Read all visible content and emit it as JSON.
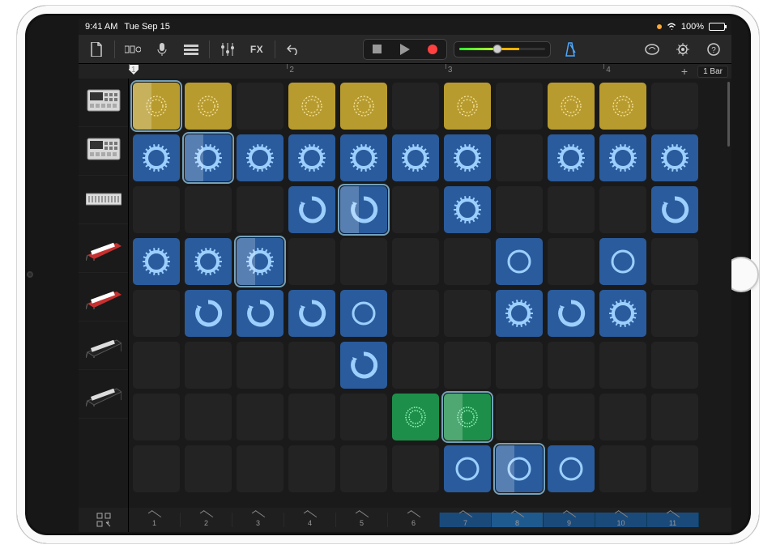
{
  "status": {
    "time": "9:41 AM",
    "date": "Tue Sep 15",
    "battery_pct": "100%"
  },
  "toolbar": {
    "fx_label": "FX",
    "metronome_on": true
  },
  "ruler": {
    "marks": [
      "1",
      "2",
      "3",
      "4"
    ],
    "add": "+",
    "zoom_label": "1 Bar"
  },
  "tracks": [
    {
      "icon": "drum-machine-1",
      "type": "drums"
    },
    {
      "icon": "drum-machine-2",
      "type": "drums"
    },
    {
      "icon": "synth-rack",
      "type": "synth"
    },
    {
      "icon": "keyboard-red-1",
      "type": "keys"
    },
    {
      "icon": "keyboard-red-2",
      "type": "keys"
    },
    {
      "icon": "keyboard-dark-1",
      "type": "keys"
    },
    {
      "icon": "keyboard-dark-2",
      "type": "keys"
    }
  ],
  "grid": {
    "cols": 11,
    "rows": 8,
    "cells": [
      [
        {
          "c": "yellow",
          "i": "dots",
          "p": true
        },
        {
          "c": "yellow",
          "i": "dots"
        },
        {
          "c": "empty"
        },
        {
          "c": "yellow",
          "i": "dots"
        },
        {
          "c": "yellow",
          "i": "dots"
        },
        {
          "c": "empty"
        },
        {
          "c": "yellow",
          "i": "dots"
        },
        {
          "c": "empty"
        },
        {
          "c": "yellow",
          "i": "dots"
        },
        {
          "c": "yellow",
          "i": "dots"
        },
        {
          "c": "empty"
        }
      ],
      [
        {
          "c": "blue",
          "i": "spike"
        },
        {
          "c": "blue",
          "i": "spike",
          "p": true
        },
        {
          "c": "blue",
          "i": "spike"
        },
        {
          "c": "blue",
          "i": "spike"
        },
        {
          "c": "blue",
          "i": "spike"
        },
        {
          "c": "blue",
          "i": "spike"
        },
        {
          "c": "blue",
          "i": "spike"
        },
        {
          "c": "empty"
        },
        {
          "c": "blue",
          "i": "spike"
        },
        {
          "c": "blue",
          "i": "spike"
        },
        {
          "c": "blue",
          "i": "spike"
        }
      ],
      [
        {
          "c": "empty"
        },
        {
          "c": "empty"
        },
        {
          "c": "empty"
        },
        {
          "c": "blue",
          "i": "arc"
        },
        {
          "c": "blue",
          "i": "arc",
          "p": true
        },
        {
          "c": "empty"
        },
        {
          "c": "blue",
          "i": "spike"
        },
        {
          "c": "empty"
        },
        {
          "c": "empty"
        },
        {
          "c": "empty"
        },
        {
          "c": "blue",
          "i": "arc"
        }
      ],
      [
        {
          "c": "blue",
          "i": "spike"
        },
        {
          "c": "blue",
          "i": "spike"
        },
        {
          "c": "blue",
          "i": "spike",
          "p": true
        },
        {
          "c": "empty"
        },
        {
          "c": "empty"
        },
        {
          "c": "empty"
        },
        {
          "c": "empty"
        },
        {
          "c": "blue",
          "i": "ring"
        },
        {
          "c": "empty"
        },
        {
          "c": "blue",
          "i": "ring"
        },
        {
          "c": "empty"
        }
      ],
      [
        {
          "c": "empty"
        },
        {
          "c": "blue",
          "i": "arc"
        },
        {
          "c": "blue",
          "i": "arc"
        },
        {
          "c": "blue",
          "i": "arc"
        },
        {
          "c": "blue",
          "i": "ring"
        },
        {
          "c": "empty"
        },
        {
          "c": "empty"
        },
        {
          "c": "blue",
          "i": "spike"
        },
        {
          "c": "blue",
          "i": "arc"
        },
        {
          "c": "blue",
          "i": "spike"
        },
        {
          "c": "empty"
        }
      ],
      [
        {
          "c": "empty"
        },
        {
          "c": "empty"
        },
        {
          "c": "empty"
        },
        {
          "c": "empty"
        },
        {
          "c": "blue",
          "i": "arc"
        },
        {
          "c": "empty"
        },
        {
          "c": "empty"
        },
        {
          "c": "empty"
        },
        {
          "c": "empty"
        },
        {
          "c": "empty"
        },
        {
          "c": "empty"
        }
      ],
      [
        {
          "c": "empty"
        },
        {
          "c": "empty"
        },
        {
          "c": "empty"
        },
        {
          "c": "empty"
        },
        {
          "c": "empty"
        },
        {
          "c": "green",
          "i": "dots"
        },
        {
          "c": "green",
          "i": "dots",
          "p": true
        },
        {
          "c": "empty"
        },
        {
          "c": "empty"
        },
        {
          "c": "empty"
        },
        {
          "c": "empty"
        }
      ],
      [
        {
          "c": "empty"
        },
        {
          "c": "empty"
        },
        {
          "c": "empty"
        },
        {
          "c": "empty"
        },
        {
          "c": "empty"
        },
        {
          "c": "empty"
        },
        {
          "c": "blue",
          "i": "ring"
        },
        {
          "c": "blue",
          "i": "ring",
          "p": true
        },
        {
          "c": "blue",
          "i": "ring"
        },
        {
          "c": "empty"
        },
        {
          "c": "empty"
        }
      ]
    ]
  },
  "columns": {
    "labels": [
      "1",
      "2",
      "3",
      "4",
      "5",
      "6",
      "7",
      "8",
      "9",
      "10",
      "11"
    ],
    "active": [
      7,
      8,
      9,
      10,
      11
    ]
  }
}
